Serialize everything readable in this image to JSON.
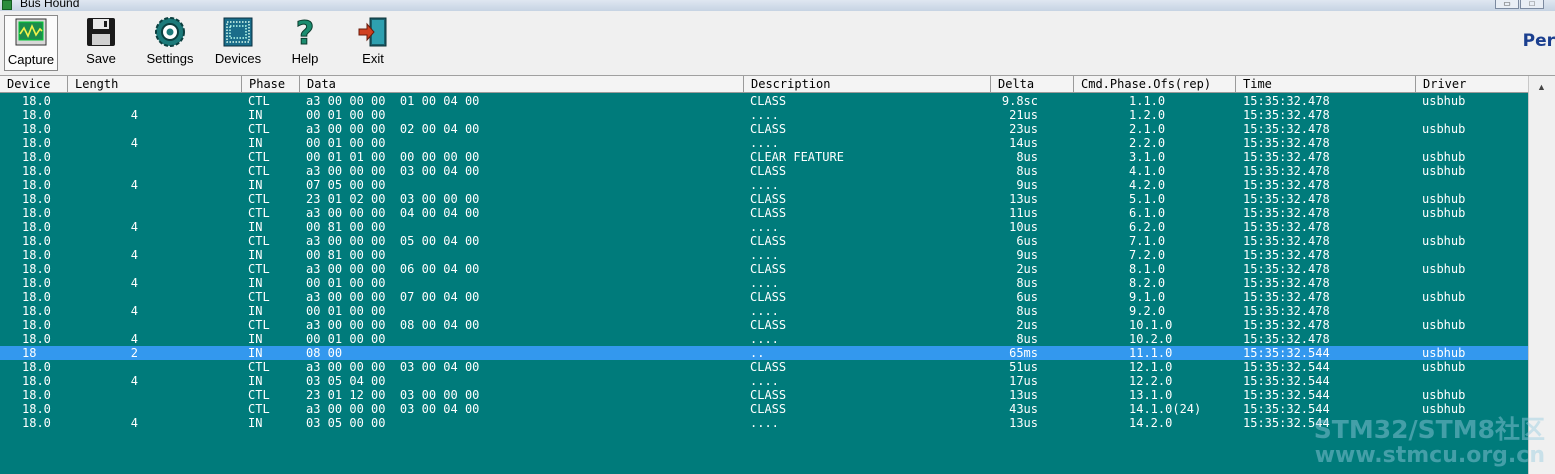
{
  "window": {
    "title": "Bus Hound"
  },
  "toolbar": {
    "capture": "Capture",
    "save": "Save",
    "settings": "Settings",
    "devices": "Devices",
    "help": "Help",
    "exit": "Exit"
  },
  "logo": {
    "text": "Per"
  },
  "columns": {
    "device": "Device",
    "length": "Length",
    "phase": "Phase",
    "data": "Data",
    "description": "Description",
    "delta": "Delta",
    "cmd": "Cmd.Phase.Ofs(rep)",
    "time": "Time",
    "driver": "Driver"
  },
  "rows": [
    {
      "device": "18.0",
      "length": "",
      "phase": "CTL",
      "data": "a3 00 00 00  01 00 04 00",
      "desc": "CLASS",
      "delta": "9.8sc",
      "cmd": "1.1.0",
      "time": "15:35:32.478",
      "driver": "usbhub"
    },
    {
      "device": "18.0",
      "length": "4",
      "phase": "IN",
      "data": "00 01 00 00",
      "desc": "....",
      "delta": "21us",
      "cmd": "1.2.0",
      "time": "15:35:32.478",
      "driver": ""
    },
    {
      "device": "18.0",
      "length": "",
      "phase": "CTL",
      "data": "a3 00 00 00  02 00 04 00",
      "desc": "CLASS",
      "delta": "23us",
      "cmd": "2.1.0",
      "time": "15:35:32.478",
      "driver": "usbhub"
    },
    {
      "device": "18.0",
      "length": "4",
      "phase": "IN",
      "data": "00 01 00 00",
      "desc": "....",
      "delta": "14us",
      "cmd": "2.2.0",
      "time": "15:35:32.478",
      "driver": ""
    },
    {
      "device": "18.0",
      "length": "",
      "phase": "CTL",
      "data": "00 01 01 00  00 00 00 00",
      "desc": "CLEAR FEATURE",
      "delta": "8us",
      "cmd": "3.1.0",
      "time": "15:35:32.478",
      "driver": "usbhub"
    },
    {
      "device": "18.0",
      "length": "",
      "phase": "CTL",
      "data": "a3 00 00 00  03 00 04 00",
      "desc": "CLASS",
      "delta": "8us",
      "cmd": "4.1.0",
      "time": "15:35:32.478",
      "driver": "usbhub"
    },
    {
      "device": "18.0",
      "length": "4",
      "phase": "IN",
      "data": "07 05 00 00",
      "desc": "....",
      "delta": "9us",
      "cmd": "4.2.0",
      "time": "15:35:32.478",
      "driver": ""
    },
    {
      "device": "18.0",
      "length": "",
      "phase": "CTL",
      "data": "23 01 02 00  03 00 00 00",
      "desc": "CLASS",
      "delta": "13us",
      "cmd": "5.1.0",
      "time": "15:35:32.478",
      "driver": "usbhub"
    },
    {
      "device": "18.0",
      "length": "",
      "phase": "CTL",
      "data": "a3 00 00 00  04 00 04 00",
      "desc": "CLASS",
      "delta": "11us",
      "cmd": "6.1.0",
      "time": "15:35:32.478",
      "driver": "usbhub"
    },
    {
      "device": "18.0",
      "length": "4",
      "phase": "IN",
      "data": "00 81 00 00",
      "desc": "....",
      "delta": "10us",
      "cmd": "6.2.0",
      "time": "15:35:32.478",
      "driver": ""
    },
    {
      "device": "18.0",
      "length": "",
      "phase": "CTL",
      "data": "a3 00 00 00  05 00 04 00",
      "desc": "CLASS",
      "delta": "6us",
      "cmd": "7.1.0",
      "time": "15:35:32.478",
      "driver": "usbhub"
    },
    {
      "device": "18.0",
      "length": "4",
      "phase": "IN",
      "data": "00 81 00 00",
      "desc": "....",
      "delta": "9us",
      "cmd": "7.2.0",
      "time": "15:35:32.478",
      "driver": ""
    },
    {
      "device": "18.0",
      "length": "",
      "phase": "CTL",
      "data": "a3 00 00 00  06 00 04 00",
      "desc": "CLASS",
      "delta": "2us",
      "cmd": "8.1.0",
      "time": "15:35:32.478",
      "driver": "usbhub"
    },
    {
      "device": "18.0",
      "length": "4",
      "phase": "IN",
      "data": "00 01 00 00",
      "desc": "....",
      "delta": "8us",
      "cmd": "8.2.0",
      "time": "15:35:32.478",
      "driver": ""
    },
    {
      "device": "18.0",
      "length": "",
      "phase": "CTL",
      "data": "a3 00 00 00  07 00 04 00",
      "desc": "CLASS",
      "delta": "6us",
      "cmd": "9.1.0",
      "time": "15:35:32.478",
      "driver": "usbhub"
    },
    {
      "device": "18.0",
      "length": "4",
      "phase": "IN",
      "data": "00 01 00 00",
      "desc": "....",
      "delta": "8us",
      "cmd": "9.2.0",
      "time": "15:35:32.478",
      "driver": ""
    },
    {
      "device": "18.0",
      "length": "",
      "phase": "CTL",
      "data": "a3 00 00 00  08 00 04 00",
      "desc": "CLASS",
      "delta": "2us",
      "cmd": "10.1.0",
      "time": "15:35:32.478",
      "driver": "usbhub"
    },
    {
      "device": "18.0",
      "length": "4",
      "phase": "IN",
      "data": "00 01 00 00",
      "desc": "....",
      "delta": "8us",
      "cmd": "10.2.0",
      "time": "15:35:32.478",
      "driver": ""
    },
    {
      "device": "18",
      "length": "2",
      "phase": "IN",
      "data": "08 00",
      "desc": "..",
      "delta": "65ms",
      "cmd": "11.1.0",
      "time": "15:35:32.544",
      "driver": "usbhub",
      "selected": true
    },
    {
      "device": "18.0",
      "length": "",
      "phase": "CTL",
      "data": "a3 00 00 00  03 00 04 00",
      "desc": "CLASS",
      "delta": "51us",
      "cmd": "12.1.0",
      "time": "15:35:32.544",
      "driver": "usbhub"
    },
    {
      "device": "18.0",
      "length": "4",
      "phase": "IN",
      "data": "03 05 04 00",
      "desc": "....",
      "delta": "17us",
      "cmd": "12.2.0",
      "time": "15:35:32.544",
      "driver": ""
    },
    {
      "device": "18.0",
      "length": "",
      "phase": "CTL",
      "data": "23 01 12 00  03 00 00 00",
      "desc": "CLASS",
      "delta": "13us",
      "cmd": "13.1.0",
      "time": "15:35:32.544",
      "driver": "usbhub"
    },
    {
      "device": "18.0",
      "length": "",
      "phase": "CTL",
      "data": "a3 00 00 00  03 00 04 00",
      "desc": "CLASS",
      "delta": "43us",
      "cmd": "14.1.0(24)",
      "time": "15:35:32.544",
      "driver": "usbhub"
    },
    {
      "device": "18.0",
      "length": "4",
      "phase": "IN",
      "data": "03 05 00 00",
      "desc": "....",
      "delta": "13us",
      "cmd": "14.2.0",
      "time": "15:35:32.544",
      "driver": ""
    }
  ],
  "watermark": {
    "line1": "STM32/STM8社区",
    "line2": "www.stmcu.org.cn"
  },
  "colors": {
    "grid_bg": "#007b7b",
    "selection": "#3398ee",
    "text": "#ffffff"
  }
}
